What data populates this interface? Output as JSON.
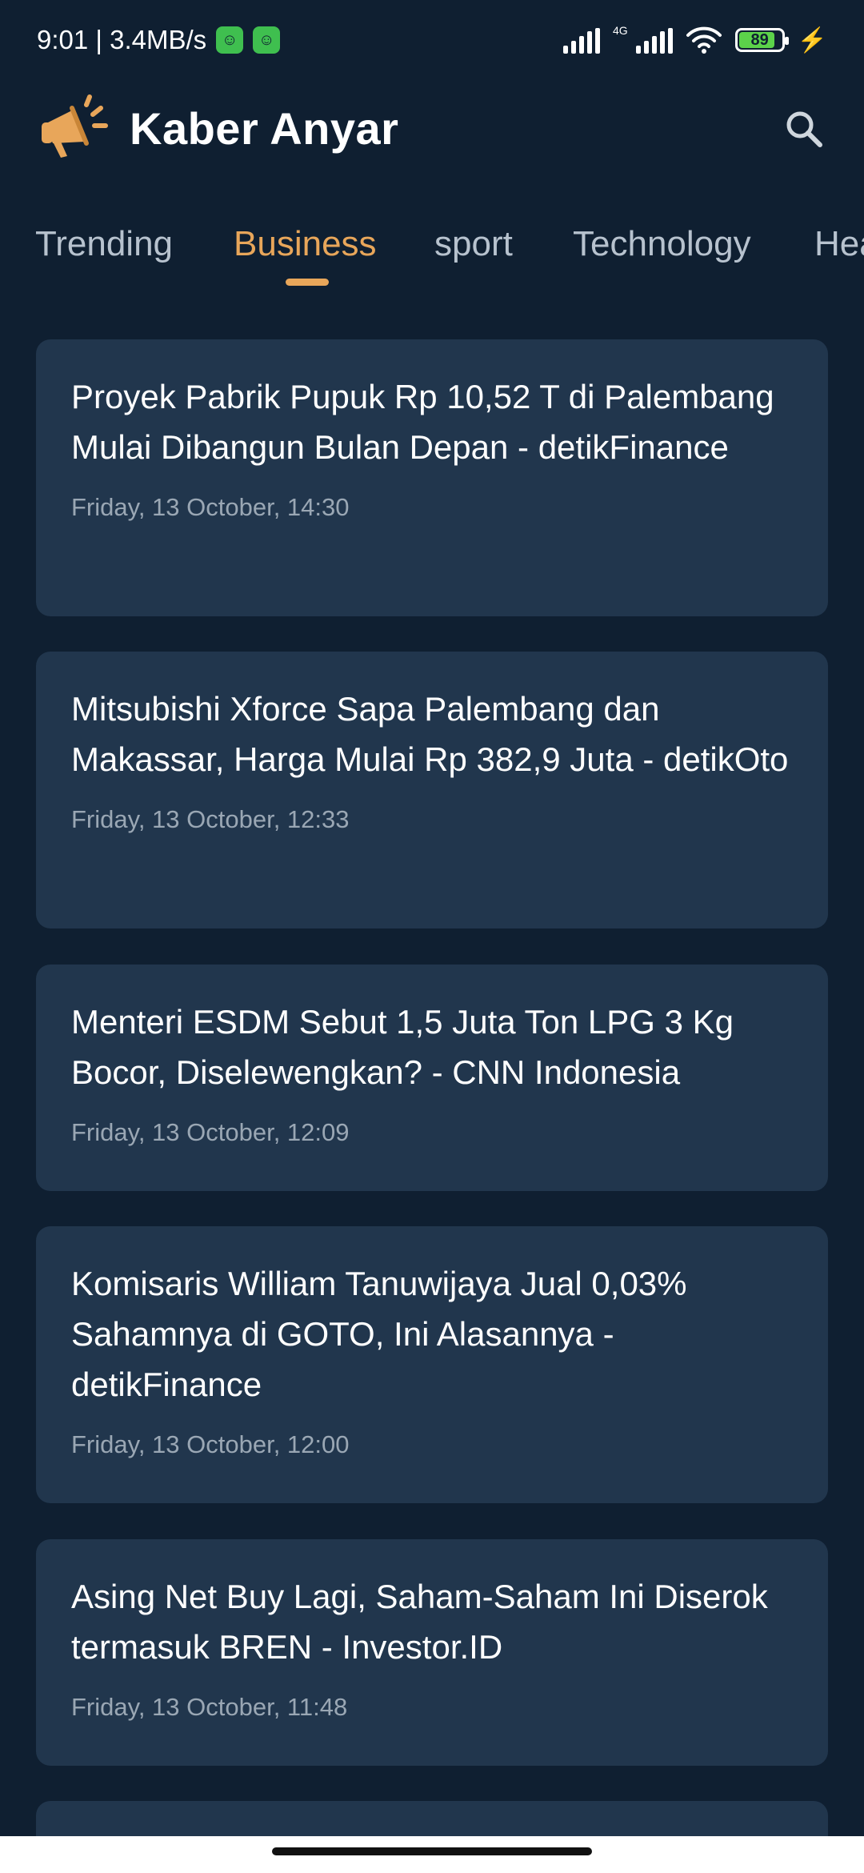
{
  "status_bar": {
    "time_speed": "9:01 | 3.4MB/s",
    "network_type": "4G",
    "battery_level": "89"
  },
  "header": {
    "title": "Kaber Anyar",
    "logo_icon": "megaphone-icon",
    "search_icon": "search-icon"
  },
  "tabs": [
    {
      "label": "Trending"
    },
    {
      "label": "Business"
    },
    {
      "label": "sport"
    },
    {
      "label": "Technology"
    },
    {
      "label": "Hea"
    }
  ],
  "active_tab": "Business",
  "articles": [
    {
      "title": "Proyek Pabrik Pupuk Rp 10,52 T di Palembang Mulai Dibangun Bulan Depan - detikFinance",
      "time": "Friday, 13 October, 14:30"
    },
    {
      "title": "Mitsubishi Xforce Sapa Palembang dan Makassar, Harga Mulai Rp 382,9 Juta - detikOto",
      "time": "Friday, 13 October, 12:33"
    },
    {
      "title": "Menteri ESDM Sebut 1,5 Juta Ton LPG 3 Kg Bocor, Diselewengkan? - CNN Indonesia",
      "time": "Friday, 13 October, 12:09"
    },
    {
      "title": "Komisaris William Tanuwijaya Jual 0,03% Sahamnya di GOTO, Ini Alasannya - detikFinance",
      "time": "Friday, 13 October, 12:00"
    },
    {
      "title": "Asing Net Buy Lagi, Saham-Saham Ini Diserok termasuk BREN - Investor.ID",
      "time": "Friday, 13 October, 11:48"
    }
  ],
  "colors": {
    "background": "#0f1f31",
    "card": "#21364d",
    "accent": "#e8a65a",
    "tab_inactive": "#b7c2ce",
    "time_text": "#9aa7b4"
  }
}
